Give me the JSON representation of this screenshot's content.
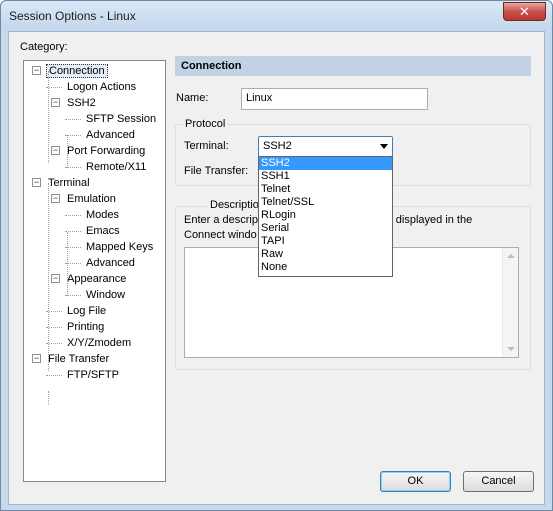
{
  "window": {
    "title": "Session Options - Linux",
    "close_glyph": "✕"
  },
  "category_label": "Category:",
  "tree": [
    {
      "label": "Connection",
      "level": 0,
      "expander": "−",
      "selected": true
    },
    {
      "label": "Logon Actions",
      "level": 1
    },
    {
      "label": "SSH2",
      "level": 1,
      "expander": "−"
    },
    {
      "label": "SFTP Session",
      "level": 2
    },
    {
      "label": "Advanced",
      "level": 2
    },
    {
      "label": "Port Forwarding",
      "level": 1,
      "expander": "−"
    },
    {
      "label": "Remote/X11",
      "level": 2
    },
    {
      "label": "Terminal",
      "level": 0,
      "expander": "−"
    },
    {
      "label": "Emulation",
      "level": 1,
      "expander": "−"
    },
    {
      "label": "Modes",
      "level": 2
    },
    {
      "label": "Emacs",
      "level": 2
    },
    {
      "label": "Mapped Keys",
      "level": 2
    },
    {
      "label": "Advanced",
      "level": 2
    },
    {
      "label": "Appearance",
      "level": 1,
      "expander": "−"
    },
    {
      "label": "Window",
      "level": 2
    },
    {
      "label": "Log File",
      "level": 1
    },
    {
      "label": "Printing",
      "level": 1
    },
    {
      "label": "X/Y/Zmodem",
      "level": 1
    },
    {
      "label": "File Transfer",
      "level": 0,
      "expander": "−"
    },
    {
      "label": "FTP/SFTP",
      "level": 1
    }
  ],
  "panel": {
    "header": "Connection",
    "name_label": "Name:",
    "name_value": "Linux",
    "protocol_title": "Protocol",
    "terminal_label": "Terminal:",
    "terminal_value": "SSH2",
    "file_transfer_label": "File Transfer:",
    "terminal_options": [
      "SSH2",
      "SSH1",
      "Telnet",
      "Telnet/SSL",
      "RLogin",
      "Serial",
      "TAPI",
      "Raw",
      "None"
    ],
    "description_title": "Description",
    "description_line1_left": "Enter a descrip",
    "description_line1_right": "onally displayed in the",
    "description_line2": "Connect windo"
  },
  "buttons": {
    "ok": "OK",
    "cancel": "Cancel"
  }
}
